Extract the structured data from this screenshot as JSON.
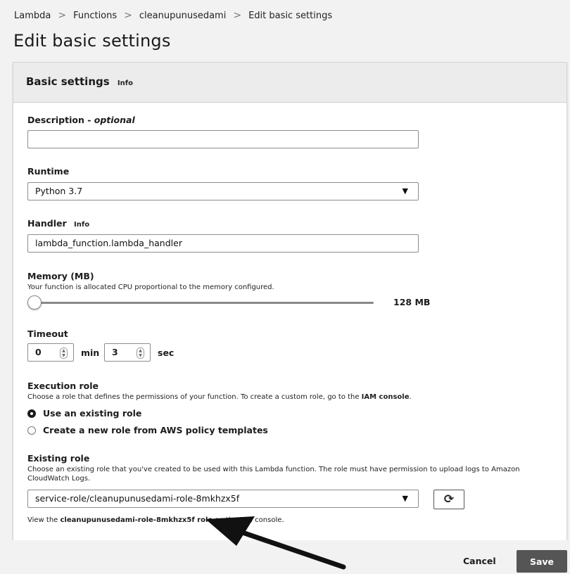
{
  "breadcrumb": {
    "items": [
      "Lambda",
      "Functions",
      "cleanupunusedami",
      "Edit basic settings"
    ],
    "separator": ">"
  },
  "page": {
    "title": "Edit basic settings"
  },
  "panel": {
    "title": "Basic settings",
    "info": "Info"
  },
  "description": {
    "label": "Description - ",
    "optional": "optional",
    "value": ""
  },
  "runtime": {
    "label": "Runtime",
    "value": "Python 3.7"
  },
  "handler": {
    "label": "Handler",
    "info": "Info",
    "value": "lambda_function.lambda_handler"
  },
  "memory": {
    "label": "Memory (MB)",
    "desc": "Your function is allocated CPU proportional to the memory configured.",
    "value_label": "128 MB",
    "value_mb": 128
  },
  "timeout": {
    "label": "Timeout",
    "min": "0",
    "min_unit": "min",
    "sec": "3",
    "sec_unit": "sec"
  },
  "execution_role": {
    "label": "Execution role",
    "desc_prefix": "Choose a role that defines the permissions of your function. To create a custom role, go to the ",
    "desc_link": "IAM console",
    "desc_suffix": ".",
    "options": [
      "Use an existing role",
      "Create a new role from AWS policy templates"
    ],
    "selected": 0
  },
  "existing_role": {
    "label": "Existing role",
    "desc": "Choose an existing role that you've created to be used with this Lambda function. The role must have permission to upload logs to Amazon CloudWatch Logs.",
    "value": "service-role/cleanupunusedami-role-8mkhzx5f",
    "view_prefix": "View the ",
    "view_link": "cleanupunusedami-role-8mkhzx5f role",
    "view_suffix": " on the IAM console."
  },
  "footer": {
    "cancel_label": "Cancel",
    "save_label": "Save"
  },
  "icons": {
    "dropdown": "caret-down-icon",
    "refresh": "refresh-icon",
    "annotation": "arrow-annotation-icon"
  }
}
